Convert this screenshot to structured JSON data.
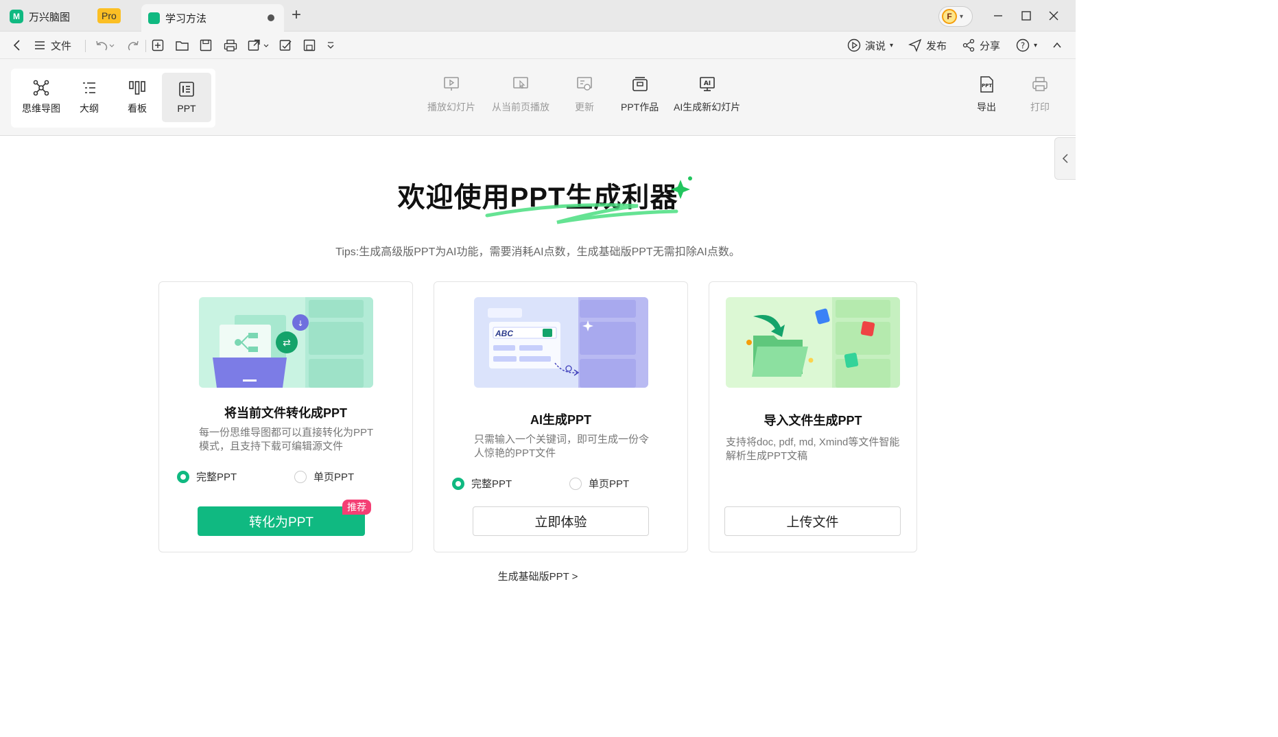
{
  "titlebar": {
    "app_name": "万兴脑图",
    "pro_label": "Pro",
    "doc_tab": "学习方法",
    "avatar_letter": "F"
  },
  "toolbar": {
    "file_label": "文件",
    "present_label": "演说",
    "publish_label": "发布",
    "share_label": "分享"
  },
  "views": [
    {
      "label": "思维导图",
      "icon": "mindmap-icon"
    },
    {
      "label": "大纲",
      "icon": "outline-icon"
    },
    {
      "label": "看板",
      "icon": "kanban-icon"
    },
    {
      "label": "PPT",
      "icon": "ppt-icon"
    }
  ],
  "ribbon": {
    "play_slides": "播放幻灯片",
    "play_from_current": "从当前页播放",
    "update": "更新",
    "ppt_works": "PPT作品",
    "ai_new_slides": "AI生成新幻灯片",
    "export": "导出",
    "print": "打印"
  },
  "hero": {
    "title": "欢迎使用PPT生成利器",
    "tips": "Tips:生成高级版PPT为AI功能，需要消耗AI点数，生成基础版PPT无需扣除AI点数。"
  },
  "cards": [
    {
      "title": "将当前文件转化成PPT",
      "desc": "每一份思维导图都可以直接转化为PPT模式，且支持下载可编辑源文件",
      "radio_full": "完整PPT",
      "radio_single": "单页PPT",
      "button": "转化为PPT",
      "badge": "推荐"
    },
    {
      "title": "AI生成PPT",
      "desc": "只需输入一个关键词，即可生成一份令人惊艳的PPT文件",
      "radio_full": "完整PPT",
      "radio_single": "单页PPT",
      "button": "立即体验",
      "img_text": "ABC"
    },
    {
      "title": "导入文件生成PPT",
      "desc": "支持将doc, pdf, md, Xmind等文件智能解析生成PPT文稿",
      "button": "上传文件"
    }
  ],
  "footer": {
    "basic_link": "生成基础版PPT >"
  },
  "colors": {
    "accent": "#10b981",
    "badge": "#f43f74",
    "pro": "#fbbf24"
  }
}
